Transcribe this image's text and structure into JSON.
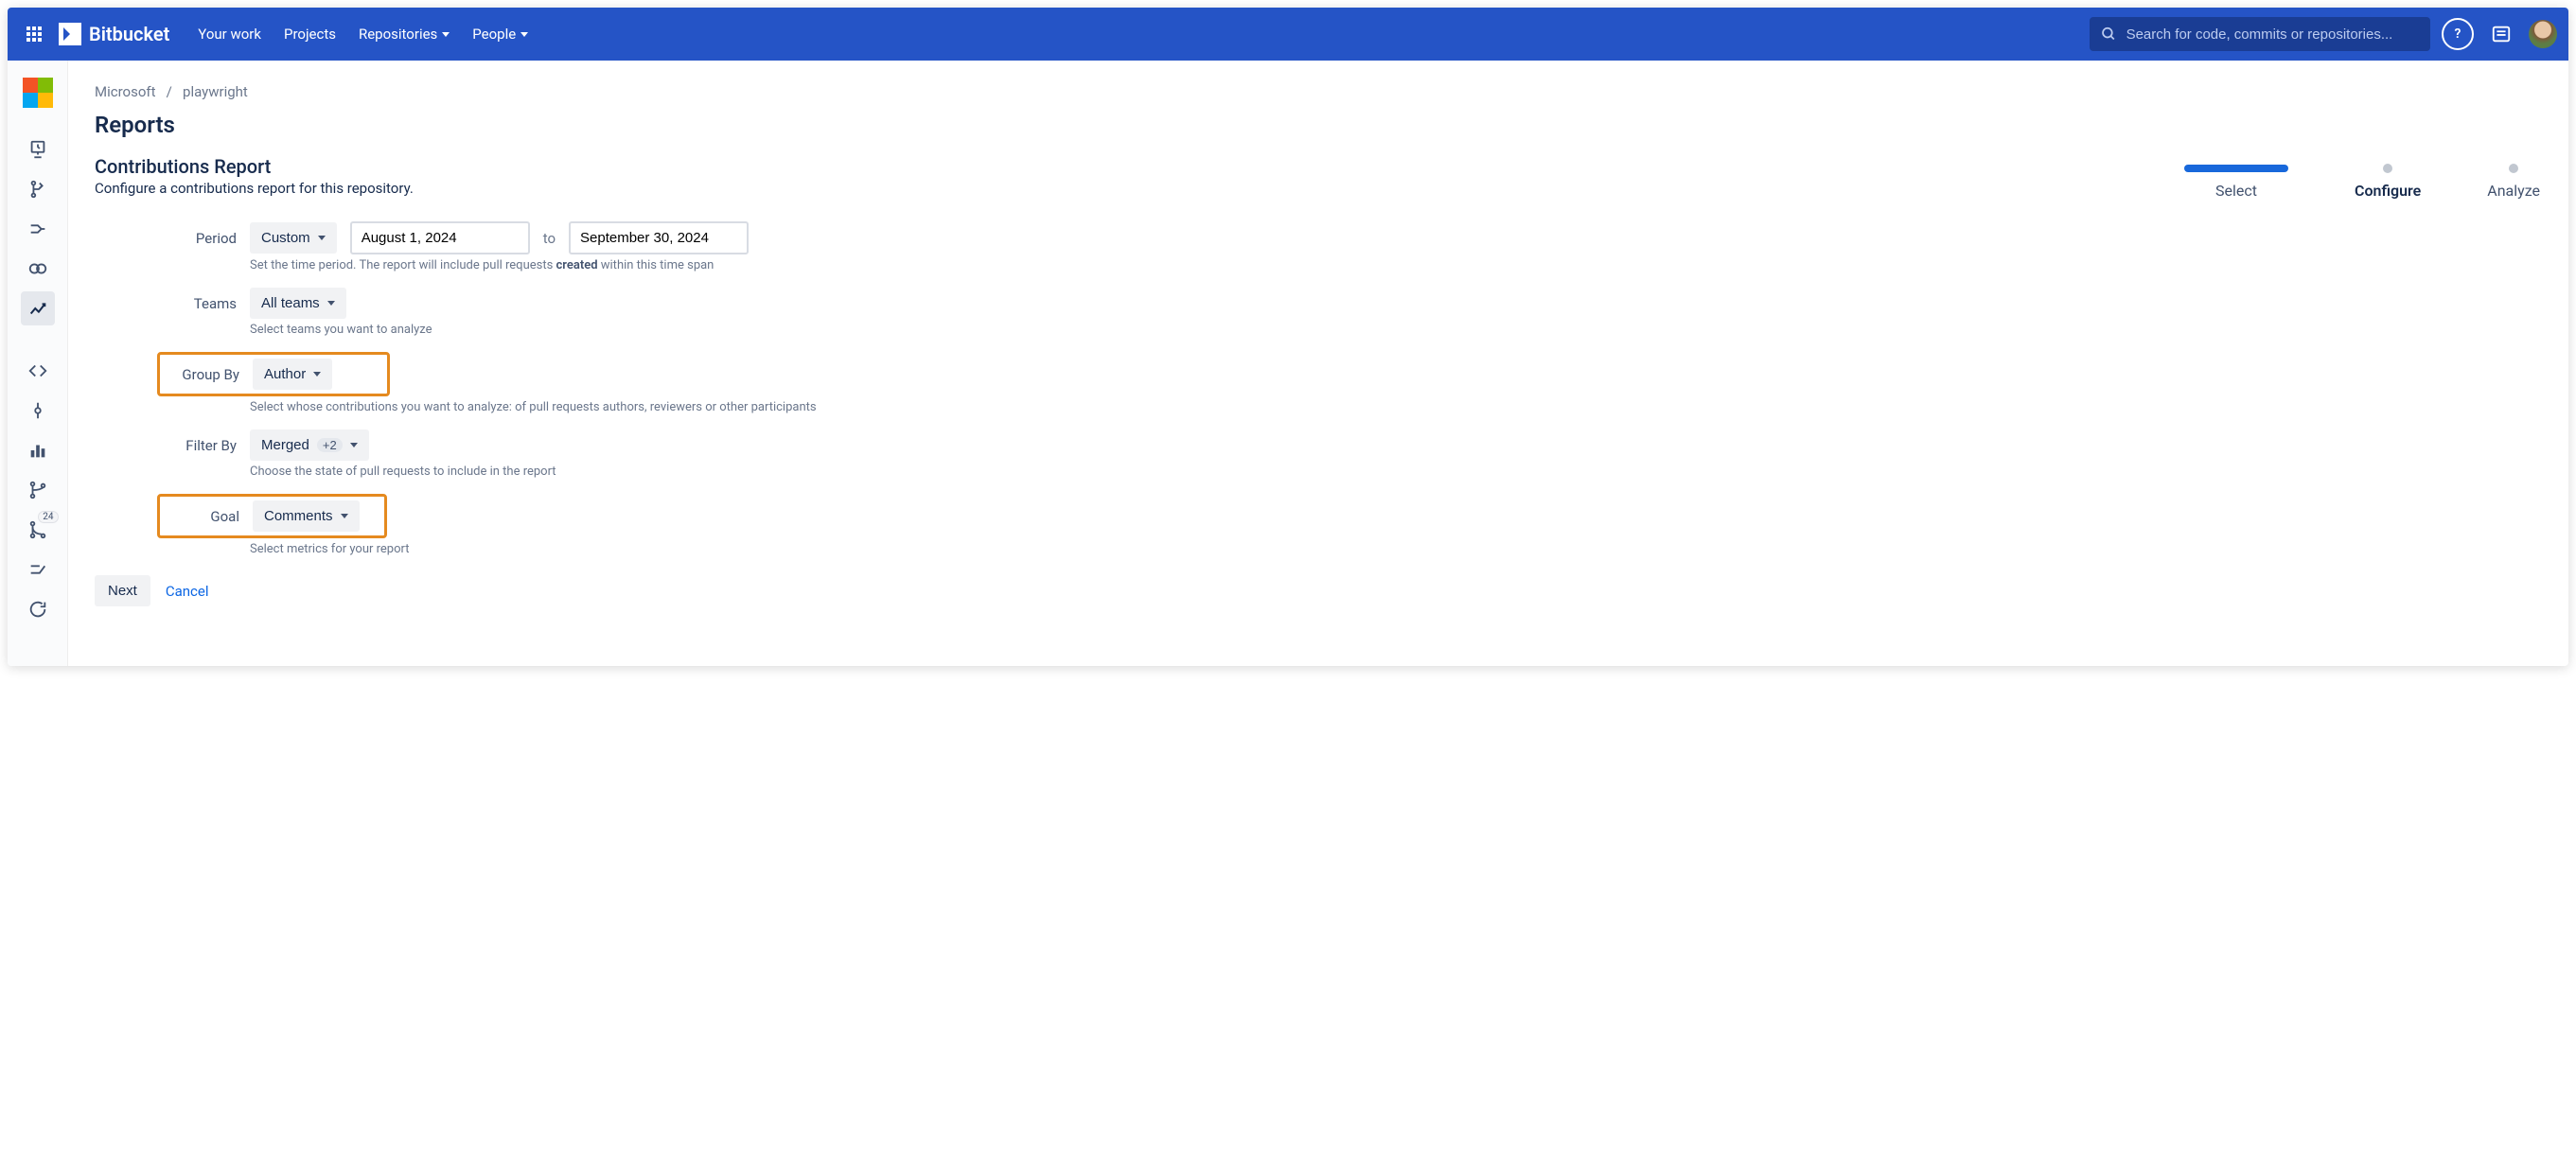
{
  "brand": "Bitbucket",
  "nav": {
    "your_work": "Your work",
    "projects": "Projects",
    "repositories": "Repositories",
    "people": "People"
  },
  "search_placeholder": "Search for code, commits or repositories...",
  "sidebar": {
    "badge_value": "24"
  },
  "breadcrumb": {
    "project": "Microsoft",
    "repo": "playwright"
  },
  "page_title": "Reports",
  "section_title": "Contributions Report",
  "section_desc": "Configure a contributions report for this repository.",
  "stepper": {
    "select": "Select",
    "configure": "Configure",
    "analyze": "Analyze"
  },
  "form": {
    "period_label": "Period",
    "period_value": "Custom",
    "date_from": "August 1, 2024",
    "to": "to",
    "date_to": "September 30, 2024",
    "period_hint_pre": "Set the time period. The report will include pull requests ",
    "period_hint_b": "created",
    "period_hint_post": " within this time span",
    "teams_label": "Teams",
    "teams_value": "All teams",
    "teams_hint": "Select teams you want to analyze",
    "groupby_label": "Group By",
    "groupby_value": "Author",
    "groupby_hint": "Select whose contributions you want to analyze: of pull requests authors, reviewers or other participants",
    "filterby_label": "Filter By",
    "filterby_value": "Merged",
    "filterby_extra": "+2",
    "filterby_hint": "Choose the state of pull requests to include in the report",
    "goal_label": "Goal",
    "goal_value": "Comments",
    "goal_hint": "Select metrics for your report"
  },
  "actions": {
    "next": "Next",
    "cancel": "Cancel"
  }
}
